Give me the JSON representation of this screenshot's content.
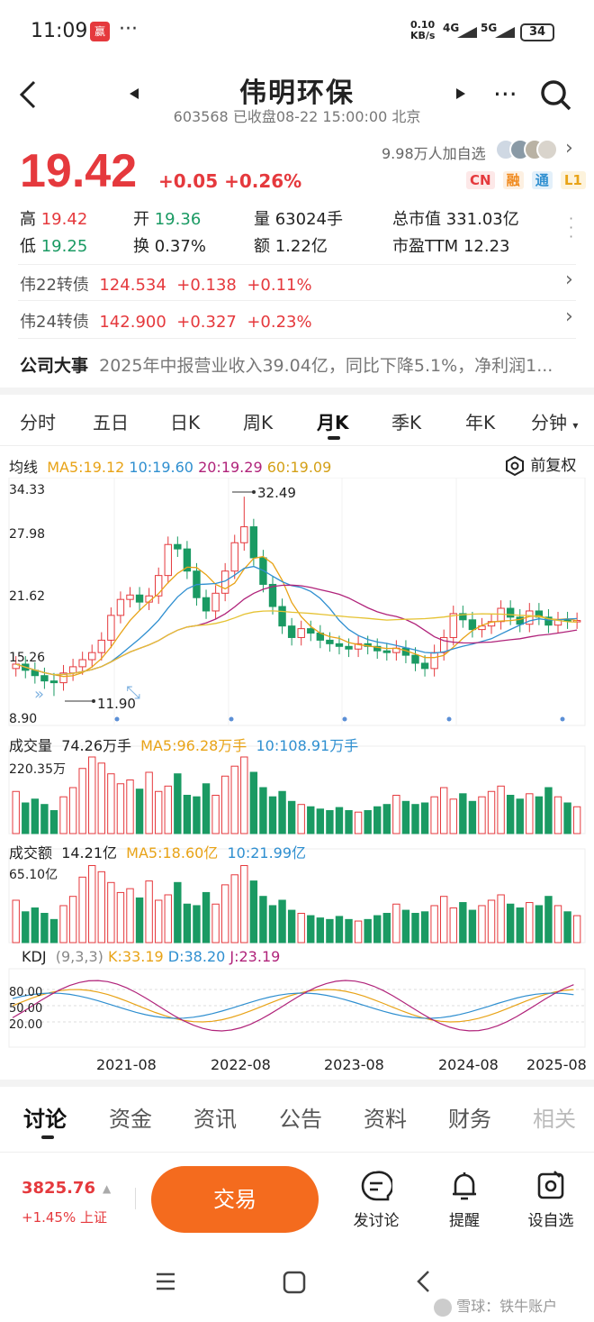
{
  "status_bar": {
    "time": "11:09",
    "net_speed_top": "0.10",
    "net_speed_unit": "KB/s",
    "sig1": "4G",
    "sig2": "5G",
    "battery": "34"
  },
  "header": {
    "title": "伟明环保",
    "code": "603568",
    "status": "已收盘08-22 15:00:00 北京"
  },
  "quote": {
    "price": "19.42",
    "change": "+0.05",
    "change_pct": "+0.26%",
    "followers": "9.98万人加自选",
    "badges": [
      "CN",
      "融",
      "通",
      "L1"
    ],
    "high_label": "高",
    "high": "19.42",
    "open_label": "开",
    "open": "19.36",
    "volume_label": "量",
    "volume": "63024手",
    "mcap_label": "总市值",
    "mcap": "331.03亿",
    "low_label": "低",
    "low": "19.25",
    "turnover_label": "换",
    "turnover": "0.37%",
    "amount_label": "额",
    "amount": "1.22亿",
    "pe_label": "市盈TTM",
    "pe": "12.23"
  },
  "bonds": [
    {
      "name": "伟22转债",
      "price": "124.534",
      "chg": "+0.138",
      "pct": "+0.11%"
    },
    {
      "name": "伟24转债",
      "price": "142.900",
      "chg": "+0.327",
      "pct": "+0.23%"
    }
  ],
  "event": {
    "label": "公司大事",
    "text": "2025年中报营业收入39.04亿，同比下降5.1%，净利润1..."
  },
  "period_tabs": [
    "分时",
    "五日",
    "日K",
    "周K",
    "月K",
    "季K",
    "年K",
    "分钟"
  ],
  "period_active": "月K",
  "ma_legend": {
    "label": "均线",
    "ma5": "MA5:19.12",
    "ma10": "10:19.60",
    "ma20": "20:19.29",
    "ma60": "60:19.09",
    "adjust": "前复权"
  },
  "price_axis": {
    "top": "34.33",
    "l2": "27.98",
    "l3": "21.62",
    "l4": "15.26",
    "bottom": "8.90",
    "high_mark": "32.49",
    "low_mark": "11.90"
  },
  "vol_legend": {
    "label": "成交量",
    "cur": "74.26万手",
    "ma5": "MA5:96.28万手",
    "ma10": "10:108.91万手",
    "max": "220.35万"
  },
  "amt_legend": {
    "label": "成交额",
    "cur": "14.21亿",
    "ma5": "MA5:18.60亿",
    "ma10": "10:21.99亿",
    "max": "65.10亿"
  },
  "kdj_legend": {
    "label": "KDJ",
    "params": "(9,3,3)",
    "k": "K:33.19",
    "d": "D:38.20",
    "j": "J:23.19",
    "l80": "80.00",
    "l50": "50.00",
    "l20": "20.00"
  },
  "x_axis": [
    "2021-08",
    "2022-08",
    "2023-08",
    "2024-08",
    "2025-08"
  ],
  "bottom_tabs": [
    "讨论",
    "资金",
    "资讯",
    "公告",
    "资料",
    "财务",
    "相关"
  ],
  "index": {
    "value": "3825.76",
    "chg": "+1.45%",
    "name": "上证"
  },
  "actions": {
    "trade": "交易",
    "discuss": "发讨论",
    "alert": "提醒",
    "watch": "设自选"
  },
  "watermark": "雪球：铁牛账户",
  "colors": {
    "up": "#e5393d",
    "down": "#1a9a63",
    "ma5": "#e8a317",
    "ma10": "#2f8fd0",
    "ma20": "#b0237a",
    "ma60": "#e5c232",
    "trade_btn": "#f46b1e"
  }
}
